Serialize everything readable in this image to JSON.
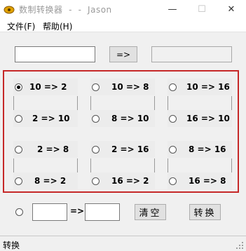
{
  "window": {
    "title": "数制转换器  -  -  Jason",
    "minimize_label": "—",
    "maximize_label": "☐",
    "close_label": "✕"
  },
  "menu": {
    "file": "文件(F)",
    "help": "帮助(H)"
  },
  "top_row": {
    "convert_arrow_label": "=>",
    "input_value": "",
    "output_value": ""
  },
  "options": [
    {
      "label": "10 => 2",
      "selected": true
    },
    {
      "label": "10 => 8",
      "selected": false
    },
    {
      "label": "10 => 16",
      "selected": false
    },
    {
      "label": "2 => 10",
      "selected": false
    },
    {
      "label": "8 => 10",
      "selected": false
    },
    {
      "label": "16 => 10",
      "selected": false
    },
    {
      "label": "2 => 8",
      "selected": false
    },
    {
      "label": "2 => 16",
      "selected": false
    },
    {
      "label": "8 => 16",
      "selected": false
    },
    {
      "label": "8 => 2",
      "selected": false
    },
    {
      "label": "16 => 2",
      "selected": false
    },
    {
      "label": "16 => 8",
      "selected": false
    }
  ],
  "custom_row": {
    "arrow_label": "=>",
    "from_value": "",
    "to_value": ""
  },
  "buttons": {
    "clear": "清空",
    "convert": "转换"
  },
  "status": {
    "text": "转换"
  },
  "colors": {
    "highlight_border": "#c62828"
  }
}
